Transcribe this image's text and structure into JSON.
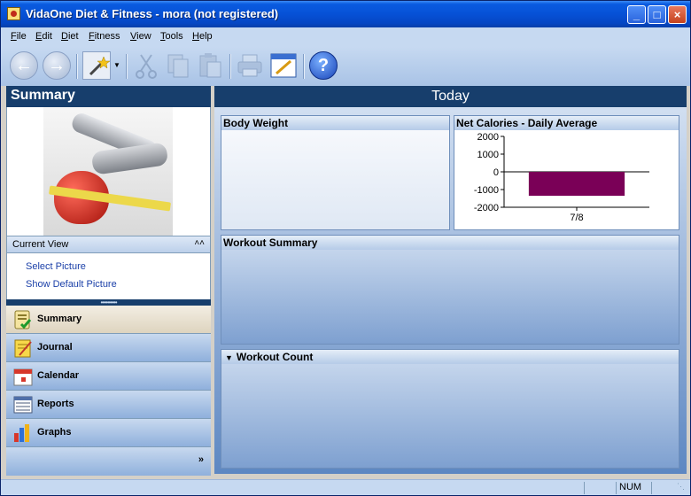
{
  "window": {
    "title": "VidaOne Diet & Fitness - mora (not registered)",
    "controls": [
      "_",
      "□",
      "×"
    ]
  },
  "menu": [
    {
      "label": "File",
      "key": "F",
      "rest": "ile"
    },
    {
      "label": "Edit",
      "key": "E",
      "rest": "dit"
    },
    {
      "label": "Diet",
      "key": "D",
      "rest": "iet"
    },
    {
      "label": "Fitness",
      "key": "F",
      "rest": "itness"
    },
    {
      "label": "View",
      "key": "V",
      "rest": "iew"
    },
    {
      "label": "Tools",
      "key": "T",
      "rest": "ools"
    },
    {
      "label": "Help",
      "key": "H",
      "rest": "elp"
    }
  ],
  "toolbar": {
    "icons": [
      "back-arrow-icon",
      "forward-arrow-icon",
      "magic-wand-icon",
      "cut-icon",
      "copy-icon",
      "paste-icon",
      "print-icon",
      "edit-window-icon",
      "help-icon"
    ]
  },
  "left": {
    "title": "Summary",
    "current_view": {
      "label": "Current View",
      "links": [
        "Select Picture",
        "Show Default Picture"
      ]
    },
    "nav": [
      {
        "label": "Summary",
        "icon": "summary-icon",
        "active": true
      },
      {
        "label": "Journal",
        "icon": "journal-icon",
        "active": false
      },
      {
        "label": "Calendar",
        "icon": "calendar-icon",
        "active": false
      },
      {
        "label": "Reports",
        "icon": "reports-icon",
        "active": false
      },
      {
        "label": "Graphs",
        "icon": "graphs-icon",
        "active": false
      }
    ],
    "more": "»"
  },
  "main": {
    "title": "Today",
    "panels": {
      "body_weight": "Body Weight",
      "net_calories": "Net Calories - Daily Average",
      "workout_summary": "Workout Summary",
      "workout_count": "Workout Count"
    }
  },
  "chart_data": {
    "type": "bar",
    "title": "Net Calories - Daily Average",
    "categories": [
      "7/8"
    ],
    "values": [
      -1350
    ],
    "ylim": [
      -2000,
      2000
    ],
    "yticks": [
      2000,
      1000,
      0,
      -1000,
      -2000
    ],
    "bar_color": "#7a0057",
    "grid": false
  },
  "statusbar": {
    "num": "NUM"
  },
  "colors": {
    "header_dark": "#173e6c",
    "title_blue": "#0651d6",
    "menu_bg": "#c6d9f1"
  }
}
